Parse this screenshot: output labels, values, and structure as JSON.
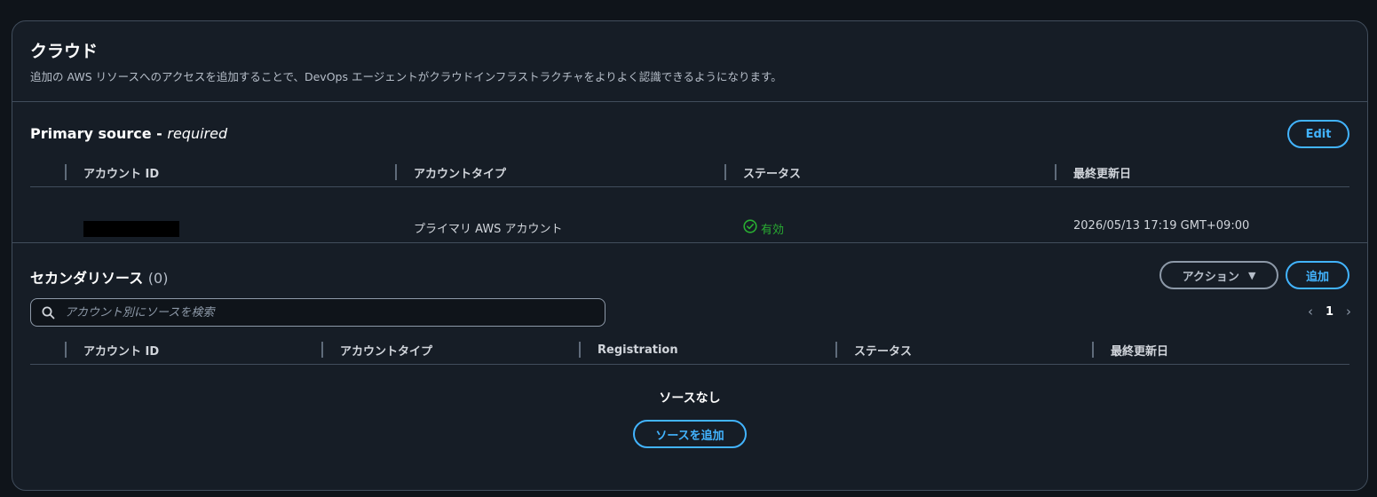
{
  "header": {
    "title": "クラウド",
    "description": "追加の AWS リソースへのアクセスを追加することで、DevOps エージェントがクラウドインフラストラクチャをよりよく認識できるようになります。"
  },
  "primary": {
    "title": "Primary source - ",
    "title_suffix": "required",
    "edit_label": "Edit",
    "columns": [
      "アカウント ID",
      "アカウントタイプ",
      "ステータス",
      "最終更新日"
    ],
    "row": {
      "account_type": "プライマリ AWS アカウント",
      "status": "有効",
      "last_updated": "2026/05/13 17:19 GMT+09:00"
    },
    "status_color": "#29ad32"
  },
  "secondary": {
    "title": "セカンダリソース",
    "count": "(0)",
    "actions_label": "アクション",
    "add_label": "追加",
    "search_placeholder": "アカウント別にソースを検索",
    "page": "1",
    "columns": [
      "アカウント ID",
      "アカウントタイプ",
      "Registration",
      "ステータス",
      "最終更新日"
    ],
    "empty_title": "ソースなし",
    "empty_button": "ソースを追加"
  },
  "icons": {
    "search": "search-icon",
    "status": "check-circle-icon",
    "dropdown": "caret-down-icon",
    "prev": "chevron-left-icon",
    "next": "chevron-right-icon"
  },
  "colors": {
    "accent": "#42b4ff",
    "background": "#0f141a",
    "panel": "#161d26"
  }
}
